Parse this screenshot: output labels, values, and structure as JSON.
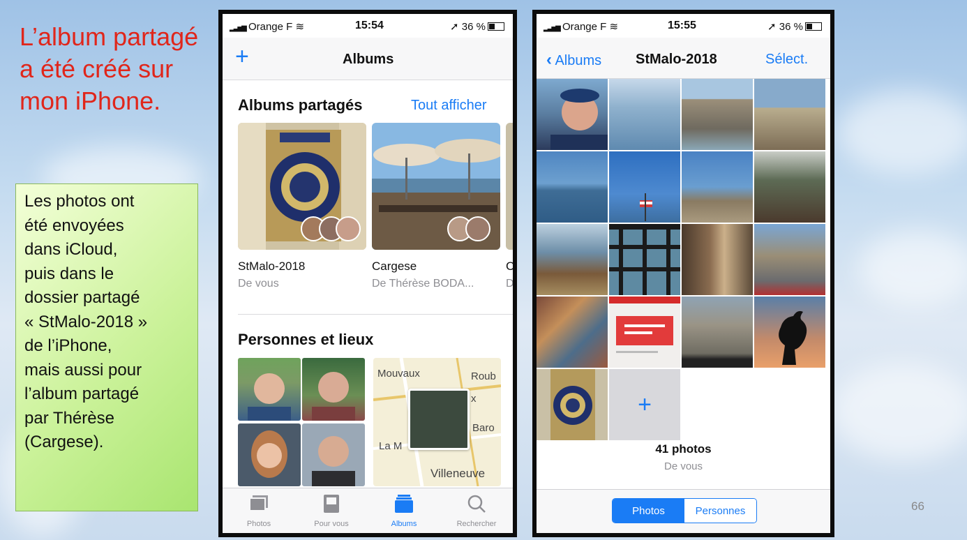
{
  "slide": {
    "title": "L’album partagé a été créé sur mon iPhone.",
    "note": [
      "Les photos ont",
      "été envoyées",
      "dans iCloud,",
      "puis dans le",
      "dossier partagé",
      "« StMalo-2018 »",
      "de l’iPhone,",
      "mais aussi pour",
      "l’album partagé",
      "par Thérèse",
      "(Cargese)."
    ],
    "page_number": "66"
  },
  "phone1": {
    "status": {
      "carrier": "Orange F",
      "time": "15:54",
      "battery": "36 %"
    },
    "nav_title": "Albums",
    "shared_title": "Albums partagés",
    "see_all": "Tout afficher",
    "albums": [
      {
        "name": "StMalo-2018",
        "owner": "De vous"
      },
      {
        "name": "Cargese",
        "owner": "De Thérèse BODA..."
      },
      {
        "name": "C",
        "owner": "D"
      }
    ],
    "people_title": "Personnes et lieux",
    "map_labels": [
      "Mouvaux",
      "Roub",
      "x",
      "Baro",
      "La M",
      "Villeneuve"
    ],
    "tabs": [
      {
        "label": "Photos",
        "icon": "photos-icon"
      },
      {
        "label": "Pour vous",
        "icon": "for-you-icon"
      },
      {
        "label": "Albums",
        "icon": "albums-icon"
      },
      {
        "label": "Rechercher",
        "icon": "search-icon"
      }
    ]
  },
  "phone2": {
    "status": {
      "carrier": "Orange F",
      "time": "15:55",
      "battery": "36 %"
    },
    "back_label": "Albums",
    "nav_title": "StMalo-2018",
    "select_label": "Sélect.",
    "add_label": "+",
    "photo_count": "41 photos",
    "owner": "De vous",
    "segments": [
      "Photos",
      "Personnes"
    ]
  },
  "colors": {
    "accent": "#1a7cf5",
    "title_red": "#e0261b",
    "note_green": "#c3ef8f"
  }
}
